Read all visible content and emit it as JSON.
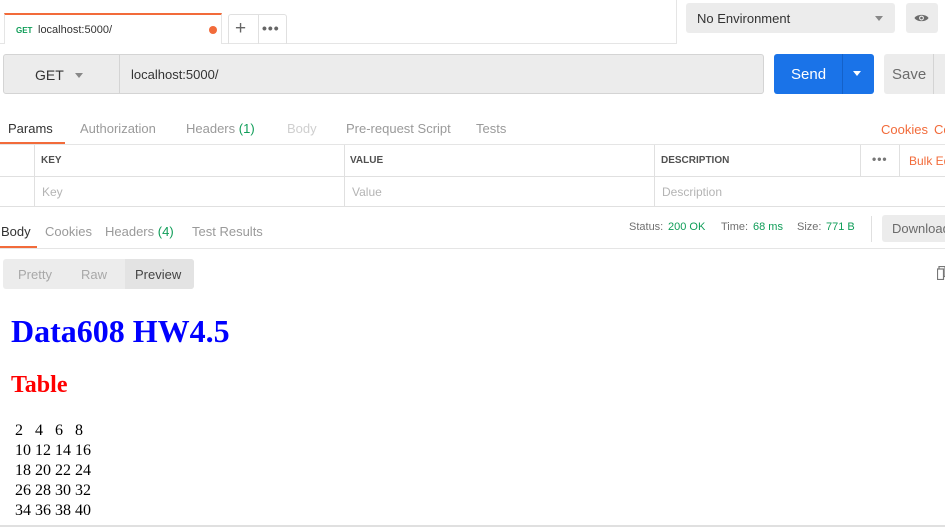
{
  "request_tab": {
    "method": "GET",
    "url": "localhost:5000/"
  },
  "environment": {
    "selected": "No Environment"
  },
  "url_bar": {
    "method": "GET",
    "url": "localhost:5000/",
    "send_label": "Send",
    "save_label": "Save"
  },
  "request_tabs": [
    {
      "label": "Params",
      "count": ""
    },
    {
      "label": "Authorization",
      "count": ""
    },
    {
      "label": "Headers",
      "count": "(1)"
    },
    {
      "label": "Body",
      "count": ""
    },
    {
      "label": "Pre-request Script",
      "count": ""
    },
    {
      "label": "Tests",
      "count": ""
    }
  ],
  "request_links": {
    "cookies": "Cookies",
    "code": "Co"
  },
  "params_table": {
    "headers": {
      "key": "KEY",
      "value": "VALUE",
      "description": "DESCRIPTION"
    },
    "bulk_edit": "Bulk Ed",
    "placeholders": {
      "key": "Key",
      "value": "Value",
      "description": "Description"
    }
  },
  "response_tabs": [
    {
      "label": "Body",
      "count": ""
    },
    {
      "label": "Cookies",
      "count": ""
    },
    {
      "label": "Headers",
      "count": "(4)"
    },
    {
      "label": "Test Results",
      "count": ""
    }
  ],
  "response_meta": {
    "status_label": "Status:",
    "status": "200 OK",
    "time_label": "Time:",
    "time": "68 ms",
    "size_label": "Size:",
    "size": "771 B",
    "download_label": "Download"
  },
  "view_modes": [
    "Pretty",
    "Raw",
    "Preview"
  ],
  "preview": {
    "heading": "Data608 HW4.5",
    "subheading": "Table",
    "rows": [
      [
        "2",
        "4",
        "6",
        "8"
      ],
      [
        "10",
        "12",
        "14",
        "16"
      ],
      [
        "18",
        "20",
        "22",
        "24"
      ],
      [
        "26",
        "28",
        "30",
        "32"
      ],
      [
        "34",
        "36",
        "38",
        "40"
      ]
    ]
  },
  "colors": {
    "accent_orange": "#f26b3a",
    "send_blue": "#1a73e8",
    "status_green": "#0f9d58",
    "heading_blue": "#0000ff",
    "subheading_red": "#ff0000"
  },
  "icons": [
    "plus-icon",
    "more-dots-icon",
    "chevron-down-icon",
    "eye-icon",
    "copy-icon"
  ]
}
